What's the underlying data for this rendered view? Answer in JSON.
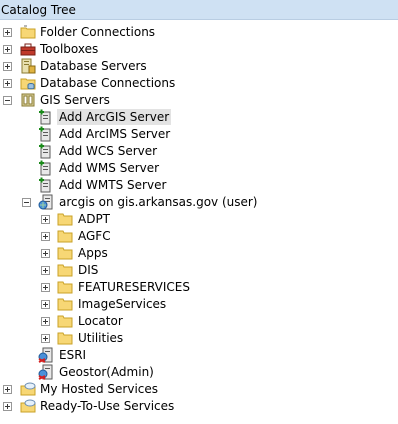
{
  "window": {
    "title": "Catalog Tree"
  },
  "tree": {
    "folder_connections": "Folder Connections",
    "toolboxes": "Toolboxes",
    "database_servers": "Database Servers",
    "database_connections": "Database Connections",
    "gis_servers": "GIS Servers",
    "add_arcgis_server": "Add ArcGIS Server",
    "add_arcims_server": "Add ArcIMS Server",
    "add_wcs_server": "Add WCS Server",
    "add_wms_server": "Add WMS Server",
    "add_wmts_server": "Add WMTS Server",
    "arcgis_connection": "arcgis on gis.arkansas.gov (user)",
    "folders": [
      "ADPT",
      "AGFC",
      "Apps",
      "DIS",
      "FEATURESERVICES",
      "ImageServices",
      "Locator",
      "Utilities"
    ],
    "esri": "ESRI",
    "geostor": "Geostor(Admin)",
    "my_hosted_services": "My Hosted Services",
    "ready_to_use_services": "Ready-To-Use Services"
  },
  "colors": {
    "title_bar": "#cfe1f3",
    "folder_fill": "#f7d775",
    "folder_edge": "#c9a227",
    "selection": "#e3e3e3"
  }
}
